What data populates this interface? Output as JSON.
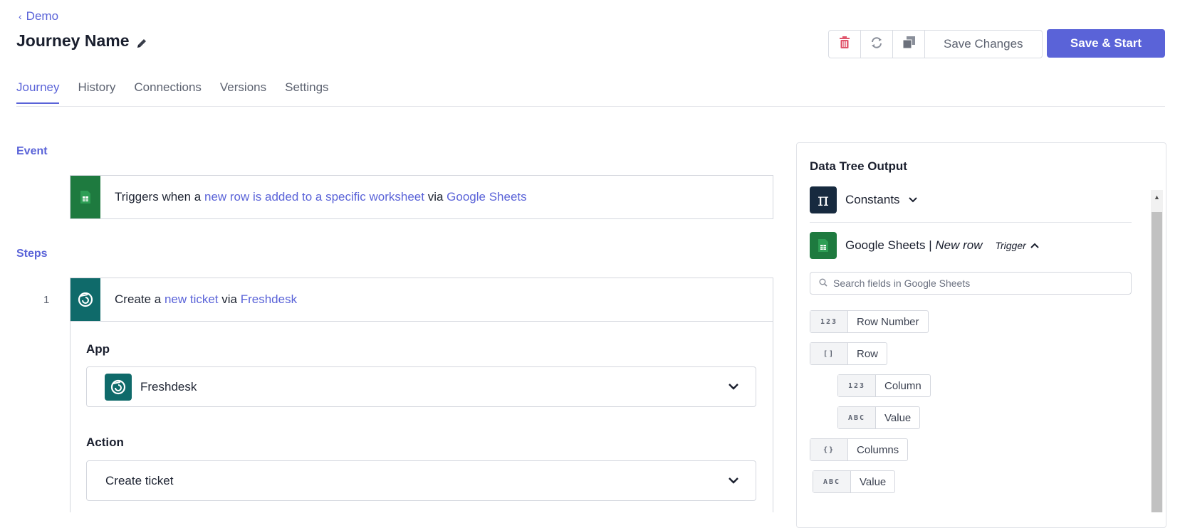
{
  "header": {
    "back_label": "Demo",
    "title": "Journey Name",
    "save_changes_label": "Save Changes",
    "save_start_label": "Save & Start"
  },
  "tabs": [
    {
      "label": "Journey",
      "active": true
    },
    {
      "label": "History"
    },
    {
      "label": "Connections"
    },
    {
      "label": "Versions"
    },
    {
      "label": "Settings"
    }
  ],
  "event": {
    "section_label": "Event",
    "text_prefix": "Triggers when a ",
    "link_trigger": "new row is added to a specific worksheet",
    "text_via": " via ",
    "link_app": "Google Sheets"
  },
  "steps": {
    "section_label": "Steps",
    "items": [
      {
        "number": "1",
        "text_prefix": "Create a ",
        "link_action": "new ticket",
        "text_via": " via ",
        "link_app": "Freshdesk",
        "app_label": "App",
        "app_value": "Freshdesk",
        "action_label": "Action",
        "action_value": "Create ticket"
      }
    ]
  },
  "data_tree": {
    "title": "Data Tree Output",
    "constants_label": "Constants",
    "source_app": "Google Sheets",
    "source_separator": " | ",
    "source_event": "New row",
    "source_badge": "Trigger",
    "search_placeholder": "Search fields in Google Sheets",
    "fields": [
      {
        "type": "123",
        "name": "Row Number"
      },
      {
        "type": "[]",
        "name": "Row"
      },
      {
        "type": "123",
        "name": "Column"
      },
      {
        "type": "ABC",
        "name": "Value"
      },
      {
        "type": "{}",
        "name": "Columns"
      },
      {
        "type": "ABC",
        "name": "Value"
      }
    ]
  },
  "colors": {
    "accent": "#5a63d8",
    "google_sheets": "#1e7a3f",
    "freshdesk": "#0f6a6a",
    "delete": "#e0556b"
  }
}
